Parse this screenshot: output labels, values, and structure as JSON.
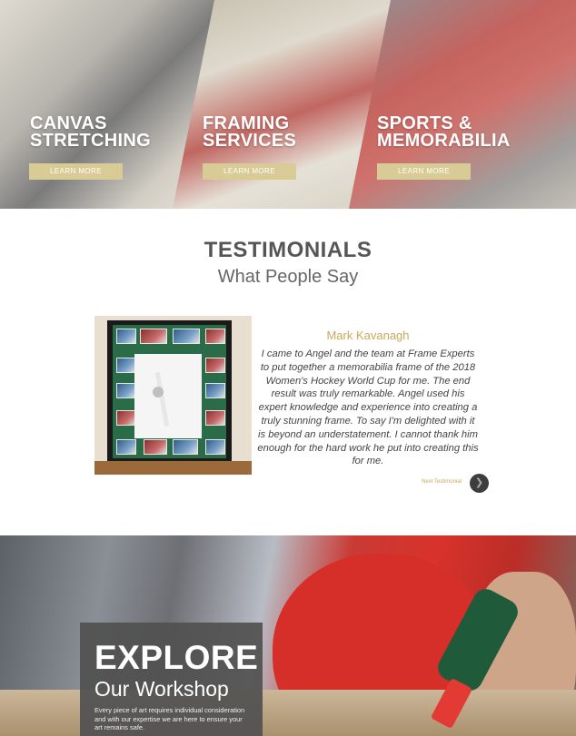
{
  "services": [
    {
      "title_line1": "CANVAS",
      "title_line2": "STRETCHING",
      "button": "LEARN MORE"
    },
    {
      "title_line1": "FRAMING",
      "title_line2": "SERVICES",
      "button": "LEARN MORE"
    },
    {
      "title_line1": "SPORTS &",
      "title_line2": "MEMORABILIA",
      "button": "LEARN MORE"
    }
  ],
  "testimonials": {
    "title": "TESTIMONIALS",
    "subtitle": "What People Say",
    "author": "Mark Kavanagh",
    "quote": "I came to Angel and the team at Frame Experts to put together a memorabilia frame of the 2018 Women's Hockey World Cup for me. The end result was truly remarkable. Angel used his expert knowledge and experience into creating a truly stunning frame. To say I'm delighted with it is beyond an understatement. I cannot thank him enough for the hard work he put into creating this for me.",
    "next_label": "Next Testimonial",
    "next_icon": "chevron-right-icon"
  },
  "workshop": {
    "title": "EXPLORE",
    "subtitle": "Our Workshop",
    "description": "Every piece of art requires individual consideration and with our expertise we are here to ensure your art remains safe."
  },
  "colors": {
    "accent_gold": "#c9a95b",
    "button_gold": "#d9cb95",
    "heading_gray": "#555555",
    "explore_box": "#505050"
  }
}
